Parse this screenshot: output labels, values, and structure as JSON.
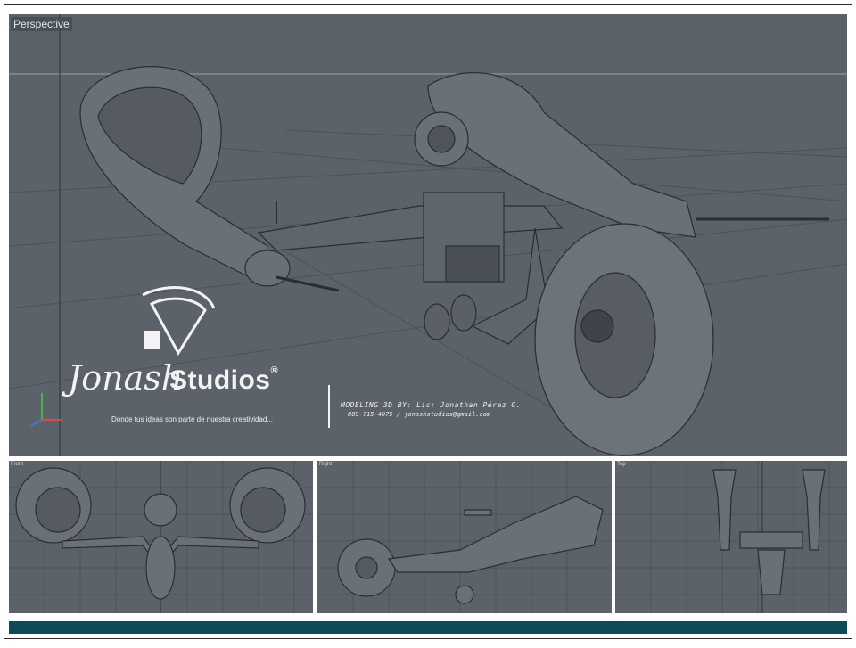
{
  "viewports": {
    "perspective": {
      "label": "Perspective"
    },
    "front": {
      "label": "Front"
    },
    "right": {
      "label": "Right"
    },
    "top": {
      "label": "Top"
    }
  },
  "branding": {
    "logo_script": "Jonash",
    "logo_word": "Studios",
    "registered_mark": "®",
    "tagline": "Donde tus ideas son parte de nuestra creatividad...",
    "credit": "MODELING 3D BY: Lic: Jonathan Pérez G.",
    "contact": "809-715-4075 / jonashstudios@gmail.com"
  },
  "axis_labels": {
    "x": "X",
    "y": "Y",
    "z": "Z"
  },
  "colors": {
    "viewport_bg": "#5b626a",
    "grid": "#4d545b",
    "model_dark": "#2a2e33",
    "model_mid": "#6e747b",
    "bottom_bar": "#0e4a5a"
  }
}
